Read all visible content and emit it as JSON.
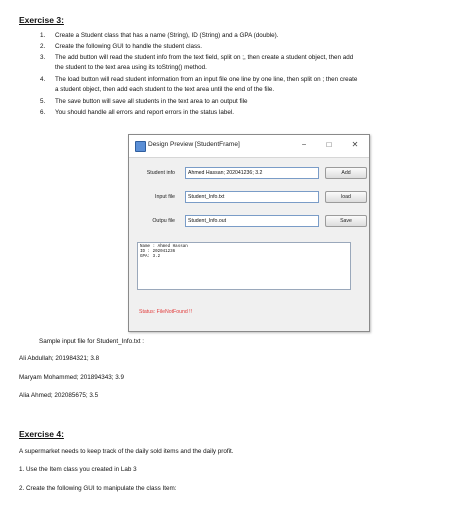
{
  "ex3": {
    "heading": "Exercise 3:",
    "items": [
      {
        "num": "1.",
        "lines": [
          "Create a Student class that has a name (String), ID (String) and a GPA (double)."
        ]
      },
      {
        "num": "2.",
        "lines": [
          "Create the following GUI to handle the student class."
        ]
      },
      {
        "num": "3.",
        "lines": [
          "The add button will read the student info from the text field, split on ;, then create a student object, then add",
          "the student to the text area using its toString() method."
        ]
      },
      {
        "num": "4.",
        "lines": [
          "The load button will read student information from an input file one line by one line, then split on ; then create",
          "a student object, then add each student to the text area until the end of the file."
        ]
      },
      {
        "num": "5.",
        "lines": [
          "The save button will save all students in the text area to an output file"
        ]
      },
      {
        "num": "6.",
        "lines": [
          "You should handle all errors and report errors in the status label."
        ]
      }
    ]
  },
  "window": {
    "title": "Design Preview [StudentFrame]",
    "minimize": "−",
    "maximize": "□",
    "close": "✕",
    "rows": [
      {
        "label": "Student info",
        "value": "Ahmed Hassan; 202041236; 3.2",
        "button": "Add"
      },
      {
        "label": "Input file",
        "value": "Student_Info.txt",
        "button": "load"
      },
      {
        "label": "Outpu file",
        "value": "Student_Info.out",
        "button": "Save"
      }
    ],
    "textarea_lines": [
      "Name : Ahmed Hassan",
      "ID : 202041236",
      "GPA: 3.2"
    ],
    "status": "Status: FileNotFound !!"
  },
  "sample": {
    "caption": "Sample input file for Student_Info.txt :",
    "lines": [
      "Ali Abdullah; 201984321; 3.8",
      "Maryam Mohammed; 201894343; 3.9",
      "Alia Ahmed; 202085675; 3.5"
    ]
  },
  "ex4": {
    "heading": "Exercise 4:",
    "intro": "A supermarket needs to keep track of the daily sold items and the daily profit.",
    "items": [
      "1. Use the Item class you created in Lab 3",
      "2. Create the following GUI to manipulate the class Item:"
    ]
  }
}
